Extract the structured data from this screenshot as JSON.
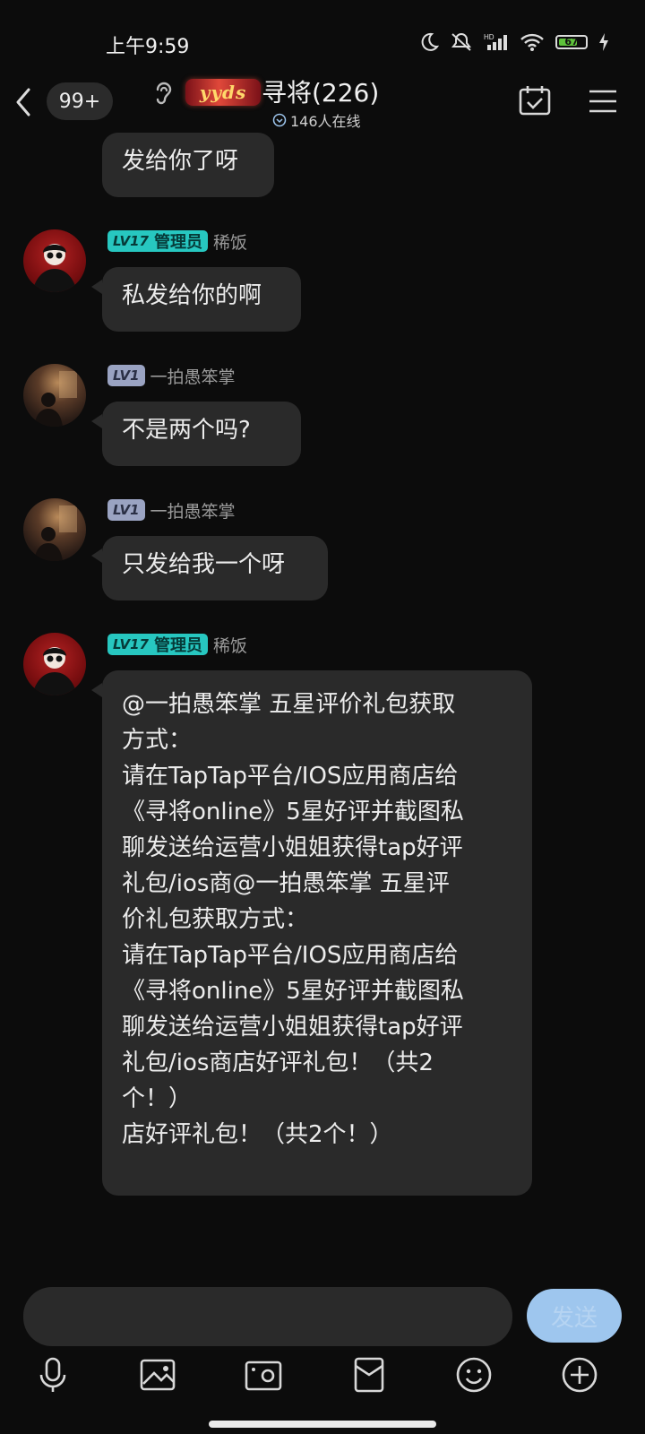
{
  "status_bar": {
    "time": "上午9:59",
    "battery": "67",
    "icons": [
      "moon-icon",
      "mute-icon",
      "signal-icon",
      "wifi-icon",
      "battery-icon",
      "charging-icon"
    ]
  },
  "header": {
    "unread_count": "99+",
    "group_badge": "yyds",
    "group_title": "寻将(226)",
    "online_text": "146人在线"
  },
  "messages": [
    {
      "text": "发给你了呀"
    },
    {
      "level": "LV17",
      "role": "管理员",
      "nickname": "稀饭",
      "text": "私发给你的啊"
    },
    {
      "level": "LV1",
      "nickname": "一拍愚笨掌",
      "text": "不是两个吗?"
    },
    {
      "level": "LV1",
      "nickname": "一拍愚笨掌",
      "text": "只发给我一个呀"
    },
    {
      "level": "LV17",
      "role": "管理员",
      "nickname": "稀饭",
      "lines": [
        "@一拍愚笨掌 五星评价礼包获取",
        "方式：",
        "请在TapTap平台/IOS应用商店给",
        "《寻将online》5星好评并截图私",
        "聊发送给运营小姐姐获得tap好评",
        "礼包/ios商@一拍愚笨掌 五星评",
        "价礼包获取方式：",
        "请在TapTap平台/IOS应用商店给",
        "《寻将online》5星好评并截图私",
        "聊发送给运营小姐姐获得tap好评",
        "礼包/ios商店好评礼包！（共2",
        "个！）",
        "店好评礼包！（共2个！）"
      ]
    }
  ],
  "input_bar": {
    "placeholder": "",
    "send_label": "发送"
  },
  "toolbar": [
    "microphone-icon",
    "image-icon",
    "camera-icon",
    "red-packet-icon",
    "emoji-icon",
    "plus-icon"
  ],
  "colors": {
    "background": "#0c0c0c",
    "bubble": "#2a2a2a",
    "admin_badge": "#27c7c0",
    "user_badge": "#9aa3c2",
    "send_button": "#9ec6ee"
  }
}
